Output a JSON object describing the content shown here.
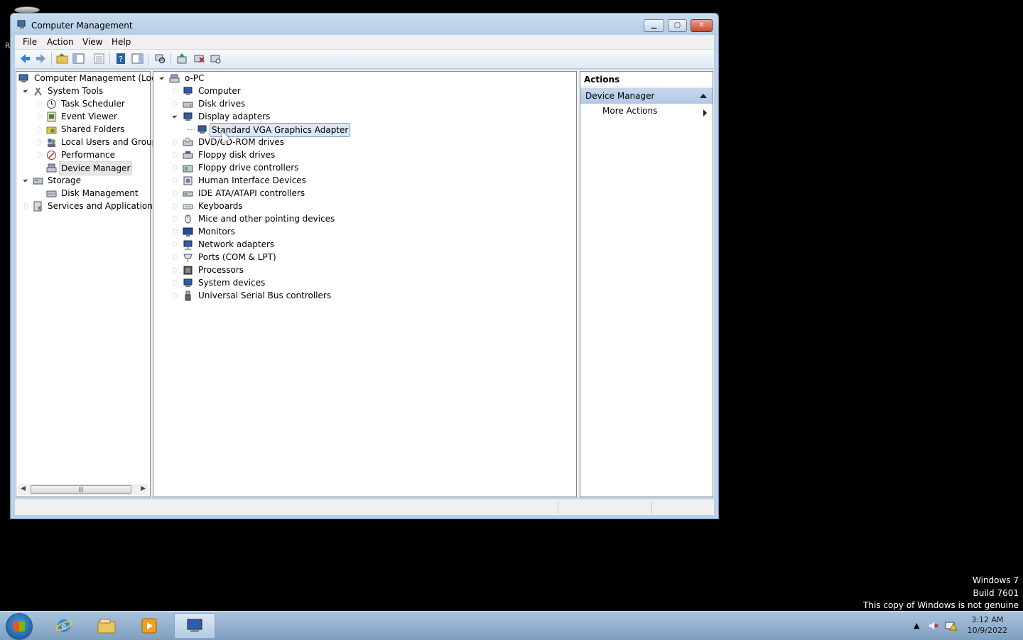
{
  "window": {
    "title": "Computer Management",
    "min": "",
    "max": "",
    "close": "✕"
  },
  "menu": [
    "File",
    "Action",
    "View",
    "Help"
  ],
  "left_tree": [
    {
      "label": "Computer Management (Local",
      "icon": "computer-management-icon"
    },
    {
      "label": "System Tools",
      "icon": "system-tools-icon"
    },
    {
      "label": "Task Scheduler",
      "icon": "clock-icon"
    },
    {
      "label": "Event Viewer",
      "icon": "event-viewer-icon"
    },
    {
      "label": "Shared Folders",
      "icon": "shared-folders-icon"
    },
    {
      "label": "Local Users and Groups",
      "icon": "users-icon"
    },
    {
      "label": "Performance",
      "icon": "performance-icon"
    },
    {
      "label": "Device Manager",
      "icon": "device-manager-icon"
    },
    {
      "label": "Storage",
      "icon": "storage-icon"
    },
    {
      "label": "Disk Management",
      "icon": "disk-management-icon"
    },
    {
      "label": "Services and Applications",
      "icon": "services-icon"
    }
  ],
  "device_tree": {
    "root": "o-PC",
    "categories": [
      "Computer",
      "Disk drives",
      "Display adapters",
      "Standard VGA Graphics Adapter",
      "DVD/CD-ROM drives",
      "Floppy disk drives",
      "Floppy drive controllers",
      "Human Interface Devices",
      "IDE ATA/ATAPI controllers",
      "Keyboards",
      "Mice and other pointing devices",
      "Monitors",
      "Network adapters",
      "Ports (COM & LPT)",
      "Processors",
      "System devices",
      "Universal Serial Bus controllers"
    ]
  },
  "actions": {
    "header": "Actions",
    "group": "Device Manager",
    "item": "More Actions"
  },
  "watermark": {
    "line1": "Windows 7",
    "line2": "Build 7601",
    "line3": "This copy of Windows is not genuine"
  },
  "clock": {
    "time": "3:12 AM",
    "date": "10/9/2022"
  },
  "desktop_letter": "R",
  "colors": {
    "title_bar": "#b9d1ea",
    "selection": "#dce8f7",
    "taskbar": "#9bb7d4"
  }
}
